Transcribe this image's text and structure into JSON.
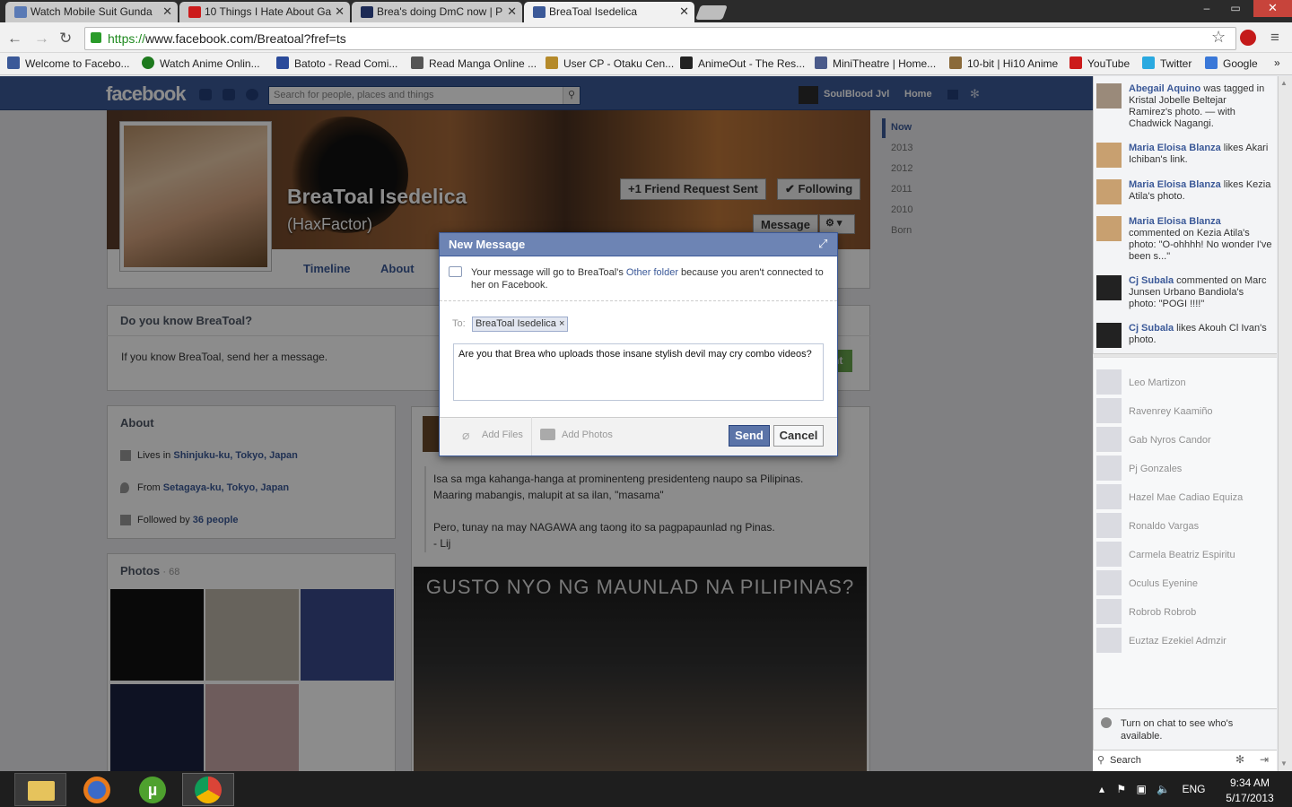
{
  "browser": {
    "tabs": [
      {
        "title": "Watch Mobile Suit Gunda",
        "color": "#5a7ab5"
      },
      {
        "title": "10 Things I Hate About Ga",
        "color": "#cc1b1b"
      },
      {
        "title": "Brea's doing DmC now | P",
        "color": "#1c2a55"
      },
      {
        "title": "BreaToal Isedelica",
        "color": "#3b5998"
      }
    ],
    "url_scheme": "https://",
    "url_rest": "www.facebook.com/Breatoal?fref=ts",
    "bookmarks": [
      {
        "label": "Welcome to Facebo...",
        "color": "#3b5998"
      },
      {
        "label": "Watch Anime Onlin...",
        "color": "#1e7a1e"
      },
      {
        "label": "Batoto - Read Comi...",
        "color": "#2a4a9a"
      },
      {
        "label": "Read Manga Online ...",
        "color": "#555555"
      },
      {
        "label": "User CP - Otaku Cen...",
        "color": "#b58a2a"
      },
      {
        "label": "AnimeOut - The Res...",
        "color": "#222222"
      },
      {
        "label": "MiniTheatre | Home...",
        "color": "#4a5a8a"
      },
      {
        "label": "10-bit | Hi10 Anime",
        "color": "#8a6a3a"
      },
      {
        "label": "YouTube",
        "color": "#cc1b1b"
      },
      {
        "label": "Twitter",
        "color": "#2aa9e0"
      },
      {
        "label": "Google",
        "color": "#3a78d8"
      }
    ],
    "more_bookmarks": "»"
  },
  "fb": {
    "logo": "facebook",
    "search_placeholder": "Search for people, places and things",
    "user": "SoulBlood Jvl",
    "home": "Home",
    "profile_name": "BreaToal Isedelica",
    "profile_alt": "(HaxFactor)",
    "btn_friend": "+1 Friend Request Sent",
    "btn_following": "✔ Following",
    "btn_message": "Message",
    "tab_timeline": "Timeline",
    "tab_about": "About",
    "years": [
      "Now",
      "2013",
      "2012",
      "2011",
      "2010",
      "Born"
    ],
    "know_title": "Do you know BreaToal?",
    "know_text": "If you know BreaToal, send her a message.",
    "about_title": "About",
    "about_items": [
      {
        "prefix": "Lives in ",
        "bold": "Shinjuku-ku, Tokyo, Japan"
      },
      {
        "prefix": "From ",
        "bold": "Setagaya-ku, Tokyo, Japan"
      },
      {
        "prefix": "Followed by ",
        "bold": "36 people"
      }
    ],
    "photos_title": "Photos",
    "photos_count": "· 68",
    "post_lines": [
      "Isa sa mga kahanga-hanga at prominenteng presidenteng naupo sa Pilipinas.",
      "Maaring mabangis, malupit at sa ilan, \"masama\"",
      "Pero, tunay na may NAGAWA ang taong ito sa pagpapaunlad ng Pinas.",
      "- Lij"
    ],
    "post_image_caption": "GUSTO NYO NG MAUNLAD NA PILIPINAS?",
    "add_friend_partial": "nt"
  },
  "modal": {
    "title": "New Message",
    "note_1": "Your message will go to BreaToal's ",
    "note_link": "Other folder",
    "note_2": " because you aren't connected to her on Facebook.",
    "to_label": "To:",
    "to_token": "BreaToal Isedelica ×",
    "message": "Are you that Brea who uploads those insane stylish devil may cry combo videos?",
    "add_files": "Add Files",
    "add_photos": "Add Photos",
    "send": "Send",
    "cancel": "Cancel"
  },
  "ticker": [
    {
      "name": "Abegail Aquino",
      "text": " was tagged in Kristal Jobelle Beltejar Ramirez's photo. — with Chadwick Nagangi."
    },
    {
      "name": "Maria Eloisa Blanza",
      "text": " likes Akari Ichiban's link."
    },
    {
      "name": "Maria Eloisa Blanza",
      "text": " likes Kezia Atila's photo."
    },
    {
      "name": "Maria Eloisa Blanza",
      "text": " commented on Kezia Atila's photo: \"O-ohhhh! No wonder I've been s...\""
    },
    {
      "name": "Cj Subala",
      "text": " commented on Marc Junsen Urbano Bandiola's photo: \"POGI !!!!\""
    },
    {
      "name": "Cj Subala",
      "text": " likes Akouh Cl Ivan's photo."
    }
  ],
  "chat": {
    "friends": [
      "Leo Martizon",
      "Ravenrey Kaamiño",
      "Gab Nyros Candor",
      "Pj Gonzales",
      "Hazel Mae Cadiao Equiza",
      "Ronaldo Vargas",
      "Carmela Beatriz Espiritu",
      "Oculus Eyenine",
      "Robrob Robrob",
      "Euztaz Ezekiel Admzir"
    ],
    "turn_on": "Turn on chat to see who's available.",
    "search": "Search"
  },
  "taskbar": {
    "lang": "ENG",
    "time": "9:34 AM",
    "date": "5/17/2013"
  }
}
